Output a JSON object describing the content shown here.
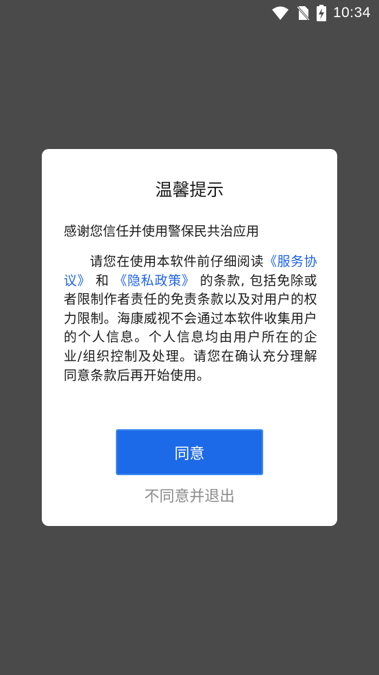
{
  "status_bar": {
    "time": "10:34",
    "icons": [
      "wifi-icon",
      "no-sim-icon",
      "battery-charging-icon"
    ]
  },
  "dialog": {
    "title": "温馨提示",
    "intro": "感谢您信任并使用警保民共治应用",
    "body": {
      "part1": "请您在使用本软件前仔细阅读",
      "link_service": "《服务协议》",
      "part2": "和",
      "link_privacy": "《隐私政策》",
      "part3": "的条款, 包括免除或者限制作者责任的免责条款以及对用户的权力限制。海康威视不会通过本软件收集用户的个人信息。个人信息均由用户所在的企业/组织控制及处理。请您在确认充分理解同意条款后再开始使用。"
    },
    "agree_label": "同意",
    "disagree_label": "不同意并退出"
  },
  "colors": {
    "overlay": "#4a4a4a",
    "link": "#1e63e9",
    "primary_button": "#1d6ae8",
    "disagree_text": "#8c8c8c"
  }
}
